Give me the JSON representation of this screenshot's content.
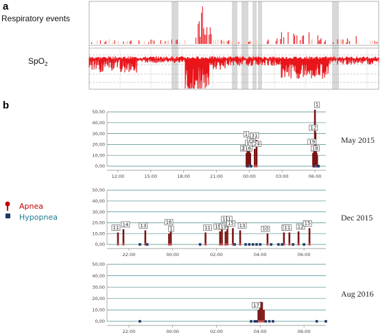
{
  "panel_a": {
    "letter": "a",
    "track_labels": {
      "events": "Respiratory events",
      "spo2_main": "SpO",
      "spo2_sub": "2"
    },
    "colors": {
      "trace": "#e8151b",
      "shade": "#d8d8d8",
      "grid": "#9c9c9c",
      "dashed": "#9c9c9c"
    }
  },
  "panel_b": {
    "letter": "b",
    "legend": [
      {
        "name": "Apnea",
        "color": "#c00000",
        "marker": "pin"
      },
      {
        "name": "Hypopnea",
        "color": "#1f3864",
        "marker": "square"
      }
    ],
    "colors": {
      "apnea": "#7b1414",
      "apnea_light": "#c0504d",
      "hypopnea": "#1f3864",
      "grid": "#4a8888",
      "axis": "#888888"
    }
  },
  "chart_data": [
    {
      "type": "bar",
      "title": "May 2015",
      "ylim": [
        0,
        50
      ],
      "y_ticks": [
        "0,00",
        "10,00",
        "20,00",
        "30,00",
        "40,00",
        "50,00"
      ],
      "x_ticks": [
        "12:00",
        "15:00",
        "18:00",
        "21:00",
        "00:00",
        "03:00",
        "06:00"
      ],
      "grid": true,
      "annotations": [
        "25",
        "17",
        "1",
        "20",
        "16",
        "24",
        "31",
        "18",
        "19",
        "1",
        "12"
      ],
      "series": [
        {
          "name": "Apnea",
          "values": [
            {
              "x": "23:45",
              "y": 12
            },
            {
              "x": "23:50",
              "y": 17
            },
            {
              "x": "23:55",
              "y": 25
            },
            {
              "x": "00:00",
              "y": 20
            },
            {
              "x": "00:05",
              "y": 12
            },
            {
              "x": "00:30",
              "y": 16
            },
            {
              "x": "00:40",
              "y": 24
            },
            {
              "x": "05:50",
              "y": 12
            },
            {
              "x": "05:55",
              "y": 18
            },
            {
              "x": "06:00",
              "y": 52
            },
            {
              "x": "06:03",
              "y": 31
            },
            {
              "x": "06:06",
              "y": 19
            },
            {
              "x": "06:09",
              "y": 12
            },
            {
              "x": "06:12",
              "y": 10
            }
          ]
        },
        {
          "name": "Hypopnea",
          "values": [
            {
              "x": "23:50",
              "y": 0
            },
            {
              "x": "00:10",
              "y": 0
            },
            {
              "x": "05:55",
              "y": 0
            },
            {
              "x": "06:15",
              "y": 0
            },
            {
              "x": "06:20",
              "y": 0
            }
          ]
        }
      ]
    },
    {
      "type": "bar",
      "title": "Dec 2015",
      "ylim": [
        0,
        50
      ],
      "y_ticks": [
        "0,00",
        "10,00",
        "20,00",
        "30,00",
        "40,00",
        "50,00"
      ],
      "x_ticks": [
        "22:00",
        "00:00",
        "02:00",
        "04:00",
        "06:00"
      ],
      "grid": true,
      "annotations": [
        "11",
        "14",
        "13",
        "1",
        "16",
        "11",
        "19",
        "1",
        "19",
        "1",
        "15",
        "13",
        "10",
        "11",
        "11",
        "12",
        "15"
      ],
      "series": [
        {
          "name": "Apnea",
          "values": [
            {
              "x": "21:30",
              "y": 11
            },
            {
              "x": "21:45",
              "y": 14
            },
            {
              "x": "22:45",
              "y": 13
            },
            {
              "x": "23:50",
              "y": 10
            },
            {
              "x": "23:55",
              "y": 16
            },
            {
              "x": "01:30",
              "y": 11
            },
            {
              "x": "02:10",
              "y": 12
            },
            {
              "x": "02:15",
              "y": 19
            },
            {
              "x": "02:25",
              "y": 12
            },
            {
              "x": "02:30",
              "y": 19
            },
            {
              "x": "02:45",
              "y": 15
            },
            {
              "x": "03:05",
              "y": 13
            },
            {
              "x": "04:20",
              "y": 10
            },
            {
              "x": "05:05",
              "y": 11
            },
            {
              "x": "05:20",
              "y": 11
            },
            {
              "x": "05:45",
              "y": 12
            },
            {
              "x": "06:15",
              "y": 15
            }
          ]
        },
        {
          "name": "Hypopnea",
          "values": [
            {
              "x": "22:30",
              "y": 0
            },
            {
              "x": "22:50",
              "y": 0
            },
            {
              "x": "01:15",
              "y": 0
            },
            {
              "x": "02:50",
              "y": 0
            },
            {
              "x": "03:20",
              "y": 0
            },
            {
              "x": "03:30",
              "y": 0
            },
            {
              "x": "03:40",
              "y": 0
            },
            {
              "x": "03:50",
              "y": 0
            },
            {
              "x": "04:00",
              "y": 0
            },
            {
              "x": "04:30",
              "y": 0
            },
            {
              "x": "04:50",
              "y": 0
            },
            {
              "x": "05:00",
              "y": 0
            },
            {
              "x": "05:30",
              "y": 0
            },
            {
              "x": "06:00",
              "y": 0
            }
          ]
        }
      ]
    },
    {
      "type": "bar",
      "title": "Aug 2016",
      "ylim": [
        0,
        50
      ],
      "y_ticks": [
        "0,00",
        "10,00",
        "20,00",
        "30,00",
        "40,00",
        "50,00"
      ],
      "x_ticks": [
        "22:00",
        "00:00",
        "02:00",
        "04:00",
        "06:00"
      ],
      "grid": true,
      "annotations": [
        "17"
      ],
      "series": [
        {
          "name": "Apnea",
          "values": [
            {
              "x": "03:55",
              "y": 10
            },
            {
              "x": "04:00",
              "y": 17
            },
            {
              "x": "04:05",
              "y": 17
            },
            {
              "x": "04:10",
              "y": 10
            }
          ]
        },
        {
          "name": "Hypopnea",
          "values": [
            {
              "x": "22:30",
              "y": 0
            },
            {
              "x": "03:35",
              "y": 0
            },
            {
              "x": "03:45",
              "y": 0
            },
            {
              "x": "03:50",
              "y": 0
            },
            {
              "x": "04:15",
              "y": 0
            },
            {
              "x": "04:25",
              "y": 0
            },
            {
              "x": "04:35",
              "y": 0
            },
            {
              "x": "06:35",
              "y": 0
            },
            {
              "x": "07:00",
              "y": 0
            }
          ]
        }
      ]
    }
  ]
}
